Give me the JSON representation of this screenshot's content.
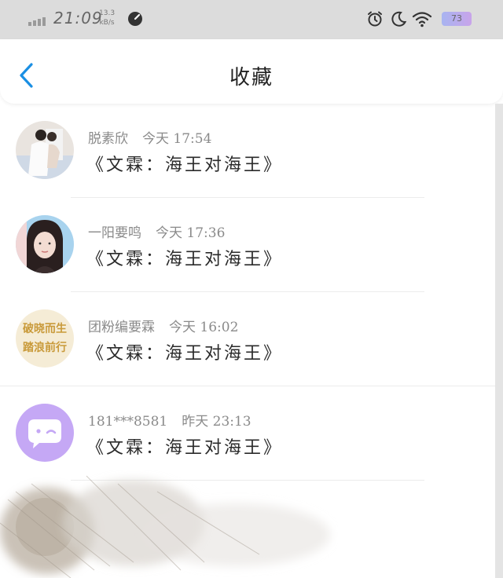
{
  "status_bar": {
    "time": "21:09",
    "speed_value": "13.3",
    "speed_unit": "kB/s",
    "battery": "73",
    "icons": [
      "signal-icon",
      "speed-gauge-icon",
      "alarm-icon",
      "moon-icon",
      "wifi-icon",
      "battery-icon"
    ]
  },
  "header": {
    "title": "收藏",
    "back_icon": "chevron-left-icon"
  },
  "colors": {
    "accent": "#1a8fe3",
    "avatar_purple": "#c5a8f5"
  },
  "favorites": [
    {
      "name": "脱素欣",
      "time": "今天 17:54",
      "title": "《文霖：海王对海王》"
    },
    {
      "name": "一阳要鸣",
      "time": "今天 17:36",
      "title": "《文霖：海王对海王》"
    },
    {
      "name": "团粉编要霖",
      "time": "今天 16:02",
      "title": "《文霖：海王对海王》",
      "avatar_text": [
        "破晓而生",
        "踏浪前行"
      ]
    },
    {
      "name": "181***8581",
      "time": "昨天 23:13",
      "title": "《文霖：海王对海王》"
    }
  ]
}
